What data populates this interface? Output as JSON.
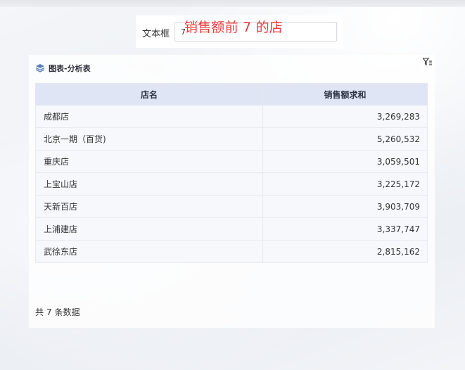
{
  "filter": {
    "label": "文本框",
    "value": "7",
    "overlay_text": "销售额前 7 的店"
  },
  "panel": {
    "title": "图表-分析表",
    "columns": [
      "店名",
      "销售额求和"
    ],
    "rows": [
      {
        "name": "成都店",
        "sales": "3,269,283"
      },
      {
        "name": "北京一期（百货)",
        "sales": "5,260,532"
      },
      {
        "name": "重庆店",
        "sales": "3,059,501"
      },
      {
        "name": "上宝山店",
        "sales": "3,225,172"
      },
      {
        "name": "天新百店",
        "sales": "3,903,709"
      },
      {
        "name": "上浦建店",
        "sales": "3,337,747"
      },
      {
        "name": "武徐东店",
        "sales": "2,815,162"
      }
    ],
    "footer": {
      "prefix": "共",
      "count": "7",
      "suffix": "条数据"
    }
  },
  "colors": {
    "accent_red": "#ee3a3a",
    "header_bg": "#dfe5f4"
  },
  "icons": {
    "title_icon": "layers-icon",
    "filter_icon": "filter-icon"
  }
}
